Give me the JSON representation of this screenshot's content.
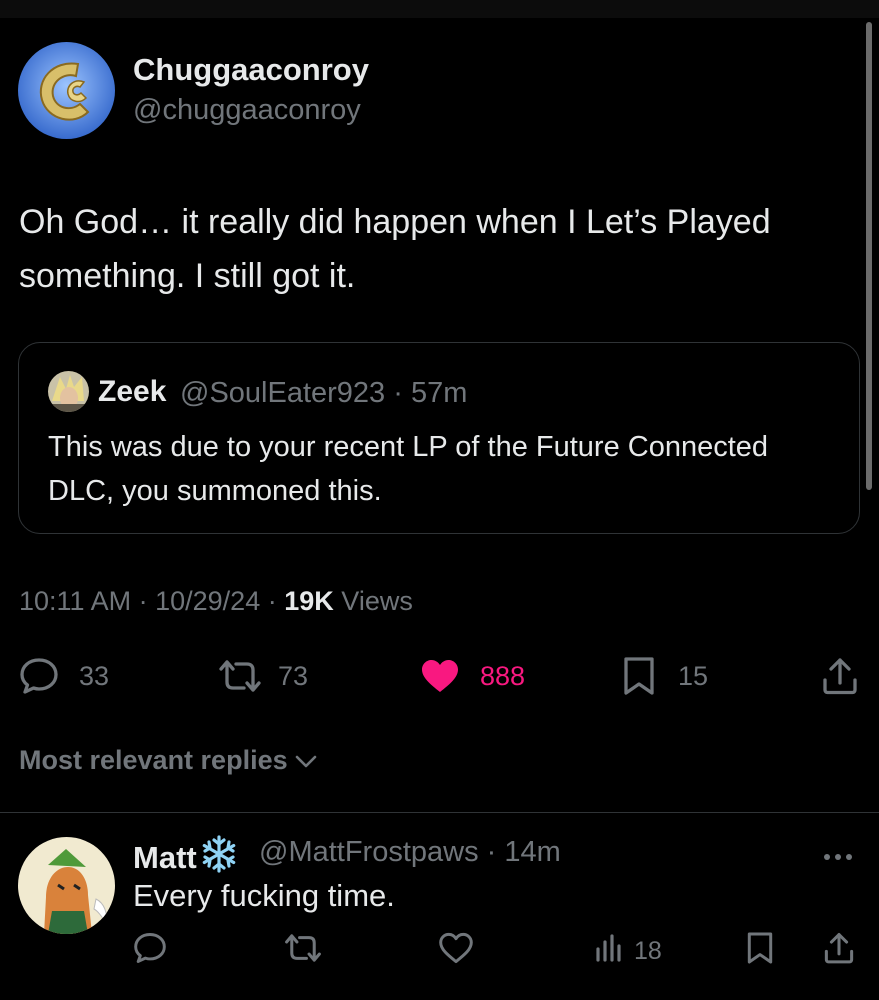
{
  "tweet": {
    "author_name": "Chuggaaconroy",
    "author_handle": "@chuggaaconroy",
    "text": "Oh God… it really did happen when I Let’s Played something. I still got it.",
    "time": "10:11 AM",
    "date": "10/29/24",
    "views_count": "19K",
    "views_label": "Views",
    "separator": "·"
  },
  "quote": {
    "name": "Zeek",
    "handle": "@SoulEater923",
    "time": "57m",
    "text": "This was due to your recent LP of the Future Connected DLC, you summoned this."
  },
  "actions": {
    "replies": "33",
    "reposts": "73",
    "likes": "888",
    "bookmarks": "15"
  },
  "replies_header": {
    "label": "Most relevant replies"
  },
  "reply": {
    "name": "Matt",
    "handle": "@MattFrostpaws",
    "time": "14m",
    "text": "Every fucking time.",
    "views": "18"
  },
  "icons": {
    "reply": "speech-bubble-icon",
    "repost": "repost-arrows-icon",
    "like": "heart-icon",
    "bookmark": "bookmark-icon",
    "share": "share-upload-icon",
    "views": "bar-chart-icon",
    "more": "more-dots-icon",
    "dropdown": "chevron-down-icon",
    "name_emoji": "snowflake-icon"
  },
  "colors": {
    "background": "#000000",
    "text_primary": "#e7e9ea",
    "text_secondary": "#71767b",
    "like_pink": "#f91880",
    "border": "#2f3336"
  }
}
